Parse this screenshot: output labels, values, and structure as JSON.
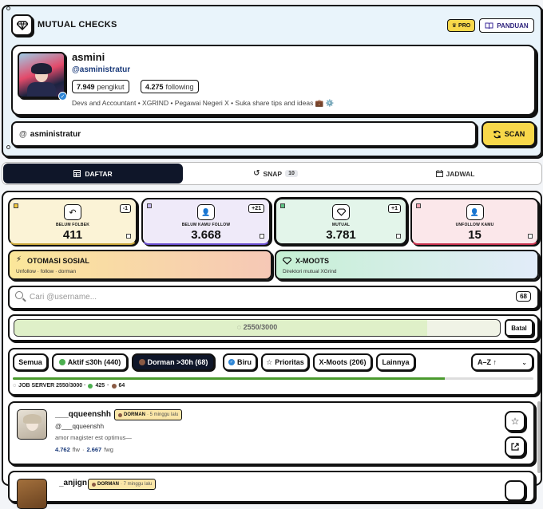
{
  "header": {
    "title": "MUTUAL CHECKS",
    "pro_label": "PRO",
    "guide_label": "PANDUAN"
  },
  "profile": {
    "name": "asmini",
    "handle": "@asministratur",
    "followers_count": "7.949",
    "followers_label": "pengikut",
    "following_count": "4.275",
    "following_label": "following",
    "bio": "Devs and Accountant • XGRIND • Pegawai Negeri X • Suka share tips and ideas 💼 ⚙️"
  },
  "search_user": {
    "prefix": "@",
    "value": "asministratur",
    "scan_label": "SCAN"
  },
  "tabs": [
    {
      "label": "DAFTAR"
    },
    {
      "label": "SNAP",
      "badge": "10"
    },
    {
      "label": "JADWAL"
    }
  ],
  "stats": [
    {
      "label": "BELUM FOLBEK",
      "value": "411",
      "delta": "-1",
      "color": "#fbf3d6"
    },
    {
      "label": "BELUM KAMU FOLLOW",
      "value": "3.668",
      "delta": "+21",
      "color": "#efeaf9"
    },
    {
      "label": "MUTUAL",
      "value": "3.781",
      "delta": "+1",
      "color": "#e3f5ea"
    },
    {
      "label": "UNFOLLOW KAMU",
      "value": "15",
      "delta": "",
      "color": "#fbe7ea"
    }
  ],
  "features": [
    {
      "title": "OTOMASI SOSIAL",
      "subtitle": "Unfollow · follow · dorman",
      "icon": "lightning-icon"
    },
    {
      "title": "X-MOOTS",
      "subtitle": "Direktori mutual XGrind",
      "icon": "diamond-icon"
    }
  ],
  "filter_search": {
    "placeholder": "Cari @username...",
    "count": "68"
  },
  "progress": {
    "text": "2550/3000",
    "fraction": 0.85,
    "cancel_label": "Batal"
  },
  "filters": [
    {
      "label": "Semua"
    },
    {
      "label": "Aktif ≤30h (440)"
    },
    {
      "label": "Dorman >30h (68)"
    },
    {
      "label": "Biru"
    },
    {
      "label": "Prioritas"
    },
    {
      "label": "X-Moots (206)"
    },
    {
      "label": "Lainnya"
    }
  ],
  "sort": {
    "label": "A–Z ↑"
  },
  "job": {
    "text": "JOB SERVER 2550/3000 ·",
    "active": "425",
    "dormant": "64",
    "progress_fraction": 0.83
  },
  "users": [
    {
      "username": "___qqueenshh",
      "status": "DORMAN",
      "last_seen": "· 5 minggu lalu",
      "handle": "@___qqueenshh",
      "bio": "amor magister est optimus—",
      "followers": "4.762",
      "followers_unit": "flw",
      "following": "2.667",
      "following_unit": "fwg"
    },
    {
      "username": "_anjign",
      "status": "DORMAN",
      "last_seen": "· 7 minggu lalu"
    }
  ],
  "colors": {
    "accent_yellow": "#f8d84a",
    "dark_navy": "#0f1629",
    "active_green": "#4caf50",
    "dormant_brown": "#8a5a44",
    "blue_badge": "#2f86d6"
  }
}
